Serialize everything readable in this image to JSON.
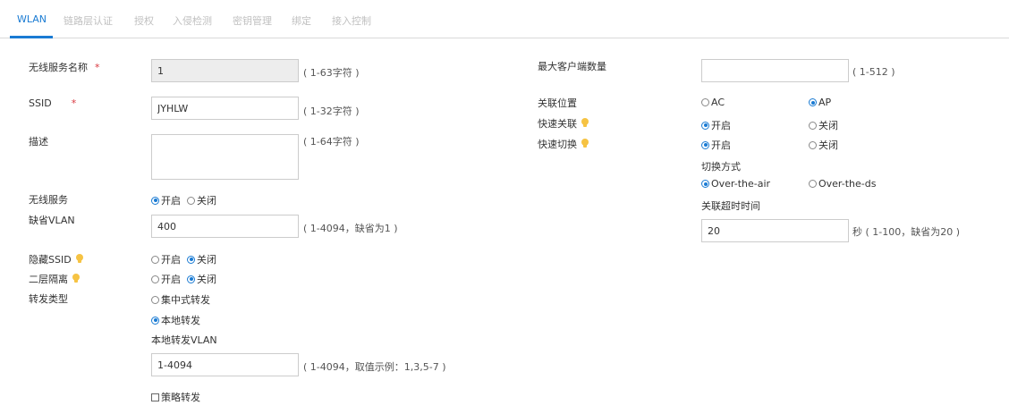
{
  "tabs": [
    "WLAN",
    "链路层认证",
    "授权",
    "入侵检测",
    "密钥管理",
    "绑定",
    "接入控制"
  ],
  "left": {
    "ssid_name": {
      "label": "无线服务名称",
      "required": "*",
      "value": "1",
      "hint": "( 1-63字符 )"
    },
    "ssid": {
      "label": "SSID",
      "required": "*",
      "value": "JYHLW",
      "hint": "( 1-32字符 )"
    },
    "description": {
      "label": "描述",
      "value": "",
      "hint": "( 1-64字符 )"
    },
    "wireless_service": {
      "label": "无线服务",
      "on": "开启",
      "off": "关闭",
      "selected": "on"
    },
    "default_vlan": {
      "label": "缺省VLAN",
      "value": "400",
      "hint": "( 1-4094，缺省为1 )"
    },
    "hide_ssid": {
      "label": "隐藏SSID",
      "on": "开启",
      "off": "关闭",
      "selected": "off"
    },
    "l2_isolation": {
      "label": "二层隔离",
      "on": "开启",
      "off": "关闭",
      "selected": "off"
    },
    "forward_type": {
      "label": "转发类型",
      "centralized": "集中式转发",
      "local": "本地转发",
      "selected": "local"
    },
    "local_forward_vlan": {
      "label": "本地转发VLAN",
      "value": "1-4094",
      "hint": "( 1-4094，取值示例：1,3,5-7 )"
    },
    "policy_forward": {
      "label": "策略转发",
      "checked": false
    }
  },
  "right": {
    "max_clients": {
      "label": "最大客户端数量",
      "value": "",
      "hint": "( 1-512 )"
    },
    "assoc_location": {
      "label": "关联位置",
      "ac": "AC",
      "ap": "AP",
      "selected": "ap"
    },
    "fast_assoc": {
      "label": "快速关联",
      "on": "开启",
      "off": "关闭",
      "selected": "on"
    },
    "fast_switch": {
      "label": "快速切换",
      "on": "开启",
      "off": "关闭",
      "selected": "on"
    },
    "switch_mode": {
      "label": "切换方式",
      "air": "Over-the-air",
      "ds": "Over-the-ds",
      "selected": "air"
    },
    "assoc_timeout": {
      "label": "关联超时时间",
      "value": "20",
      "hint": "秒 ( 1-100，缺省为20 )"
    }
  },
  "colors": {
    "accent": "#1a7bd3",
    "required": "#d9363e",
    "tip": "#f6c343"
  }
}
